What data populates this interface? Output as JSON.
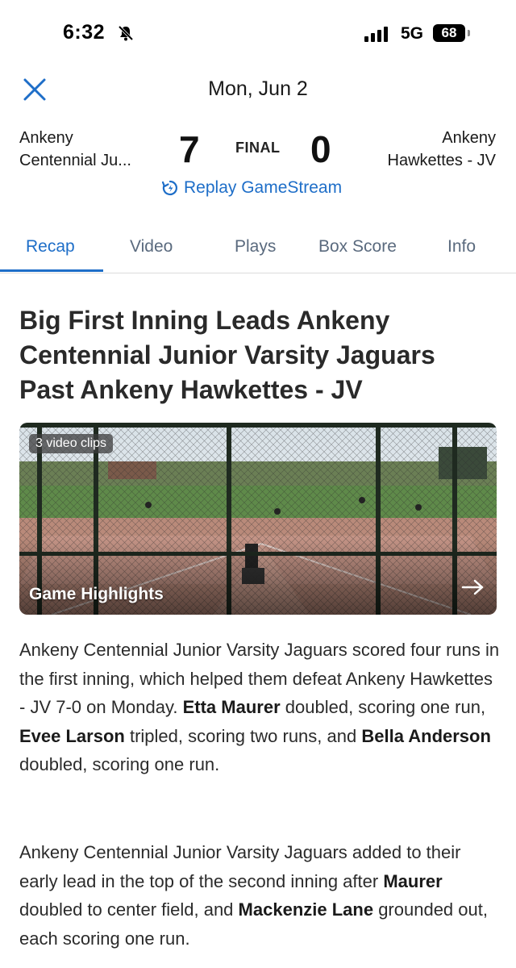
{
  "status_bar": {
    "time": "6:32",
    "network": "5G",
    "battery": "68"
  },
  "header": {
    "date": "Mon, Jun 2"
  },
  "score": {
    "home_team_line1": "Ankeny",
    "home_team_line2": "Centennial Ju...",
    "home_score": "7",
    "status": "FINAL",
    "away_score": "0",
    "away_team_line1": "Ankeny",
    "away_team_line2": "Hawkettes - JV",
    "replay_label": "Replay GameStream"
  },
  "tabs": [
    {
      "label": "Recap",
      "active": true
    },
    {
      "label": "Video",
      "active": false
    },
    {
      "label": "Plays",
      "active": false
    },
    {
      "label": "Box Score",
      "active": false
    },
    {
      "label": "Info",
      "active": false
    }
  ],
  "article": {
    "headline": "Big First Inning Leads Ankeny Centennial Junior Varsity Jaguars Past Ankeny Hawkettes - JV",
    "video": {
      "clip_count": "3 video clips",
      "title": "Game Highlights"
    },
    "p1": {
      "t1": "Ankeny Centennial Junior Varsity Jaguars scored four runs in the first inning, which helped them defeat Ankeny Hawkettes - JV 7-0 on Monday.",
      "b1": "Etta Maurer",
      "t2": "doubled, scoring one run,",
      "b2": "Evee Larson",
      "t3": "tripled, scoring two runs, and",
      "b3": "Bella Anderson",
      "t4": "doubled, scoring one run."
    },
    "p2": {
      "t1": "Ankeny Centennial Junior Varsity Jaguars added to their early lead in the top of the second inning after",
      "b1": "Maurer",
      "t2": "doubled to center field, and",
      "b2": "Mackenzie Lane",
      "t3": "grounded out, each scoring one run."
    }
  },
  "colors": {
    "accent": "#1e6ec8",
    "tab_inactive": "#5a6a7e"
  }
}
